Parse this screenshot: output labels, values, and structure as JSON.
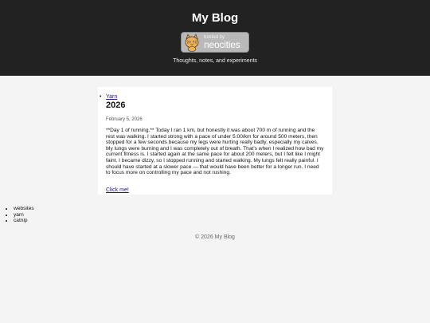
{
  "header": {
    "title": "My Blog",
    "badge": {
      "hosted_by": "hosted by",
      "brand": "neocities",
      "icon": "neocities-cat-icon"
    },
    "tagline": "Thoughts, notes, and experiments"
  },
  "post": {
    "tag": "Yarn",
    "title": "2026",
    "date": "February 5, 2026",
    "body": "**Day 1 of running.** Today I ran 1 km, but honestly it was about 700 m of running and the rest was walking. I started strong with a pace of under 5:00/km for around 500 meters, then stopped for a few seconds because my legs were hurting really badly, especially my calves. My lungs were burning and I was completely out of breath. That's when I realized how bad my current fitness is. I started again at the same pace for about 200 meters, but I felt like I might faint. I became dizzy, so I stopped running and started walking. My lungs felt really painful. I should have started at a slower pace — that would have been better for a longer run. I need to focus more on controlling my pace and not rushing.",
    "link": "Click me!"
  },
  "categories": [
    "websites",
    "yarn",
    "catnip"
  ],
  "footer": {
    "text": "© 2026 My Blog"
  },
  "colors": {
    "header_bg": "#222222",
    "page_bg": "#f4f4f4",
    "link": "#1a0dab"
  }
}
